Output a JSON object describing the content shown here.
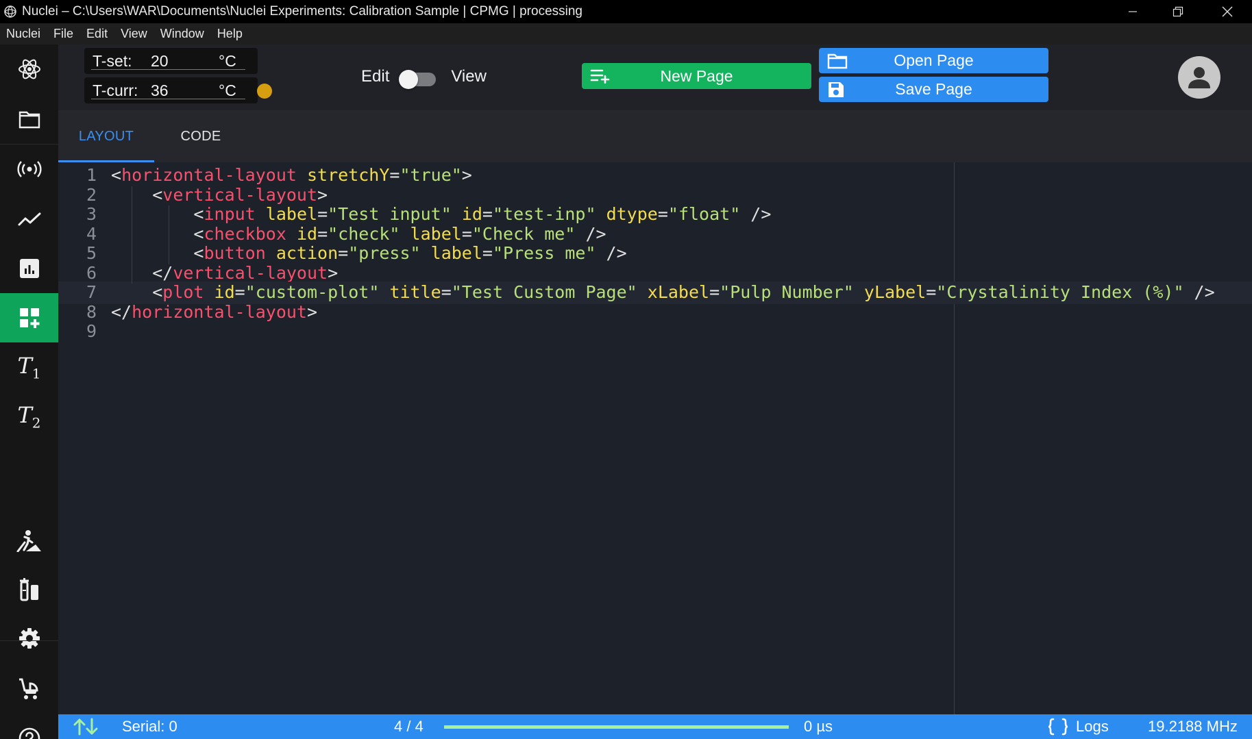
{
  "window": {
    "title": "Nuclei – C:\\Users\\WAR\\Documents\\Nuclei Experiments: Calibration Sample | CPMG | processing"
  },
  "menu": [
    "Nuclei",
    "File",
    "Edit",
    "View",
    "Window",
    "Help"
  ],
  "sidebar": {
    "items": [
      {
        "icon": "atom-icon"
      },
      {
        "icon": "folder-icon"
      },
      {
        "icon": "broadcast-icon"
      },
      {
        "icon": "line-chart-icon"
      },
      {
        "icon": "bar-chart-icon"
      },
      {
        "icon": "dashboard-add-icon",
        "active": true
      },
      {
        "icon": "t1-icon",
        "label_main": "T",
        "label_sub": "1"
      },
      {
        "icon": "t2-icon",
        "label_main": "T",
        "label_sub": "2"
      },
      {
        "icon": "hiking-icon"
      },
      {
        "icon": "flask-icon"
      },
      {
        "icon": "gear-icon"
      },
      {
        "icon": "stroller-icon"
      },
      {
        "icon": "help-icon"
      }
    ],
    "active_color": "#0ea55a"
  },
  "temperature": {
    "set_label": "T-set:",
    "set_value": "20",
    "curr_label": "T-curr:",
    "curr_value": "36",
    "unit": "°C",
    "status_color": "#d69f10"
  },
  "mode_toggle": {
    "left_label": "Edit",
    "right_label": "View"
  },
  "buttons": {
    "new_page": "New Page",
    "open_page": "Open Page",
    "save_page": "Save Page"
  },
  "tabs": {
    "layout": "LAYOUT",
    "code": "CODE",
    "active": "LAYOUT"
  },
  "editor": {
    "active_line": 7,
    "lines": [
      {
        "num": "1",
        "tokens": [
          [
            "p",
            "<"
          ],
          [
            "t",
            "horizontal-layout"
          ],
          [
            "p",
            " "
          ],
          [
            "a",
            "stretchY"
          ],
          [
            "p",
            "="
          ],
          [
            "s",
            "\"true\""
          ],
          [
            "p",
            ">"
          ]
        ]
      },
      {
        "num": "2",
        "tokens": [
          [
            "p",
            "    <"
          ],
          [
            "t",
            "vertical-layout"
          ],
          [
            "p",
            ">"
          ]
        ]
      },
      {
        "num": "3",
        "tokens": [
          [
            "p",
            "        <"
          ],
          [
            "t",
            "input"
          ],
          [
            "p",
            " "
          ],
          [
            "a",
            "label"
          ],
          [
            "p",
            "="
          ],
          [
            "s",
            "\"Test input\""
          ],
          [
            "p",
            " "
          ],
          [
            "a",
            "id"
          ],
          [
            "p",
            "="
          ],
          [
            "s",
            "\"test-inp\""
          ],
          [
            "p",
            " "
          ],
          [
            "a",
            "dtype"
          ],
          [
            "p",
            "="
          ],
          [
            "s",
            "\"float\""
          ],
          [
            "p",
            " />"
          ]
        ]
      },
      {
        "num": "4",
        "tokens": [
          [
            "p",
            "        <"
          ],
          [
            "t",
            "checkbox"
          ],
          [
            "p",
            " "
          ],
          [
            "a",
            "id"
          ],
          [
            "p",
            "="
          ],
          [
            "s",
            "\"check\""
          ],
          [
            "p",
            " "
          ],
          [
            "a",
            "label"
          ],
          [
            "p",
            "="
          ],
          [
            "s",
            "\"Check me\""
          ],
          [
            "p",
            " />"
          ]
        ]
      },
      {
        "num": "5",
        "tokens": [
          [
            "p",
            "        <"
          ],
          [
            "t",
            "button"
          ],
          [
            "p",
            " "
          ],
          [
            "a",
            "action"
          ],
          [
            "p",
            "="
          ],
          [
            "s",
            "\"press\""
          ],
          [
            "p",
            " "
          ],
          [
            "a",
            "label"
          ],
          [
            "p",
            "="
          ],
          [
            "s",
            "\"Press me\""
          ],
          [
            "p",
            " />"
          ]
        ]
      },
      {
        "num": "6",
        "tokens": [
          [
            "p",
            "    </"
          ],
          [
            "t",
            "vertical-layout"
          ],
          [
            "p",
            ">"
          ]
        ]
      },
      {
        "num": "7",
        "tokens": [
          [
            "p",
            "    <"
          ],
          [
            "t",
            "plot"
          ],
          [
            "p",
            " "
          ],
          [
            "a",
            "id"
          ],
          [
            "p",
            "="
          ],
          [
            "s",
            "\"custom-plot\""
          ],
          [
            "p",
            " "
          ],
          [
            "a",
            "title"
          ],
          [
            "p",
            "="
          ],
          [
            "s",
            "\"Test Custom Page\""
          ],
          [
            "p",
            " "
          ],
          [
            "a",
            "xLabel"
          ],
          [
            "p",
            "="
          ],
          [
            "s",
            "\"Pulp Number\""
          ],
          [
            "p",
            " "
          ],
          [
            "a",
            "yLabel"
          ],
          [
            "p",
            "="
          ],
          [
            "s",
            "\"Crystalinity Index (%)\""
          ],
          [
            "p",
            " />"
          ]
        ]
      },
      {
        "num": "8",
        "tokens": [
          [
            "p",
            "</"
          ],
          [
            "t",
            "horizontal-layout"
          ],
          [
            "p",
            ">"
          ]
        ]
      },
      {
        "num": "9",
        "tokens": []
      }
    ],
    "colors": {
      "tag": "#f7516e",
      "attr": "#f4dd4d",
      "string": "#b8e07a",
      "punct": "#e0e0e0"
    }
  },
  "status": {
    "serial": "Serial: 0",
    "scans": "4 / 4",
    "progress": 1.0,
    "time": "0 µs",
    "logs": "Logs",
    "frequency": "19.2188 MHz"
  }
}
